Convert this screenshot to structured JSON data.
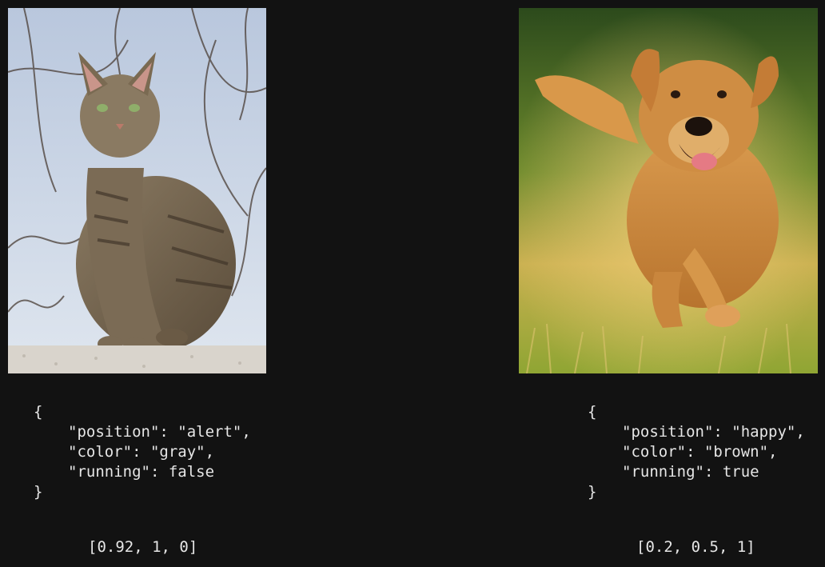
{
  "cards": [
    {
      "subject": "cat",
      "json_open": "{",
      "json_close": "}",
      "lines": [
        "\"position\": \"alert\",",
        "\"color\": \"gray\",",
        "\"running\": false"
      ],
      "vector": "[0.92, 1, 0]"
    },
    {
      "subject": "dog",
      "json_open": "{",
      "json_close": "}",
      "lines": [
        "\"position\": \"happy\",",
        "\"color\": \"brown\",",
        "\"running\": true"
      ],
      "vector": "[0.2, 0.5, 1]"
    }
  ],
  "colors": {
    "background": "#121212",
    "text": "#e6e6e6"
  }
}
